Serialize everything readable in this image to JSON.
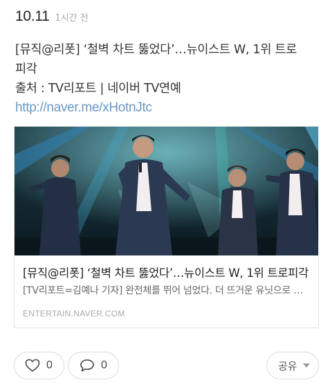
{
  "post": {
    "date": "10.11",
    "time_ago": "1시간 전",
    "text_line1": "[뮤직@리폿] ‘철벽 차트 뚫었다’…뉴이스트 W, 1위 트로",
    "text_line2": "피각",
    "text_line3": "출처 : TV리포트 | 네이버 TV연예",
    "link": "http://naver.me/xHotnJtc"
  },
  "card": {
    "title": "[뮤직@리폿] ‘철벽 차트 뚫었다’…뉴이스트 W, 1위 트로피각",
    "description": "[TV리포트=김예나 기자] 완전체를 뛰어 넘었다. 더 뜨거운 유닛으로 돌아왔다.",
    "source": "ENTERTAIN.NAVER.COM",
    "image_icon": "concert-stage-photo"
  },
  "actions": {
    "like_count": "0",
    "comment_count": "0",
    "share_label": "공유",
    "like_icon": "heart-outline-icon",
    "comment_icon": "speech-bubble-icon",
    "share_icon": "caret-down-icon"
  }
}
